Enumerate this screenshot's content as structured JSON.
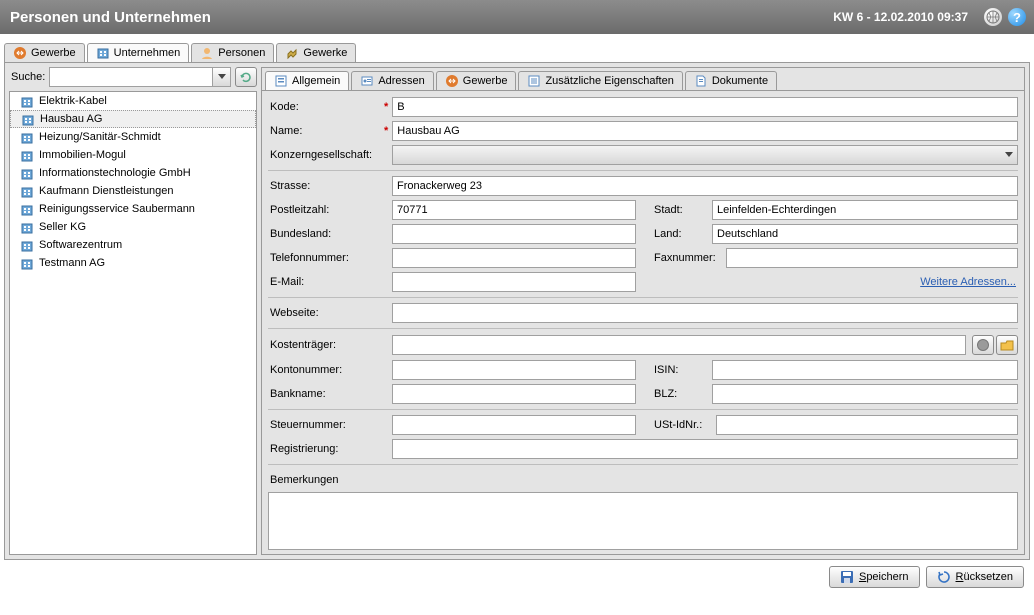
{
  "header": {
    "title": "Personen und Unternehmen",
    "date": "KW 6 - 12.02.2010 09:37"
  },
  "outer_tabs": [
    {
      "label": "Gewerbe",
      "icon": "gewerbe-icon"
    },
    {
      "label": "Unternehmen",
      "icon": "company-icon",
      "selected": true
    },
    {
      "label": "Personen",
      "icon": "person-icon"
    },
    {
      "label": "Gewerke",
      "icon": "gewerke-icon"
    }
  ],
  "search": {
    "label": "Suche:",
    "value": ""
  },
  "companies": [
    {
      "name": "Elektrik-Kabel"
    },
    {
      "name": "Hausbau AG",
      "selected": true
    },
    {
      "name": "Heizung/Sanitär-Schmidt"
    },
    {
      "name": "Immobilien-Mogul"
    },
    {
      "name": "Informationstechnologie GmbH"
    },
    {
      "name": "Kaufmann Dienstleistungen"
    },
    {
      "name": "Reinigungsservice Saubermann"
    },
    {
      "name": "Seller KG"
    },
    {
      "name": "Softwarezentrum"
    },
    {
      "name": "Testmann AG"
    }
  ],
  "inner_tabs": [
    {
      "label": "Allgemein",
      "icon": "general-icon",
      "selected": true
    },
    {
      "label": "Adressen",
      "icon": "address-icon"
    },
    {
      "label": "Gewerbe",
      "icon": "gewerbe-icon"
    },
    {
      "label": "Zusätzliche Eigenschaften",
      "icon": "properties-icon"
    },
    {
      "label": "Dokumente",
      "icon": "document-icon"
    }
  ],
  "labels": {
    "kode": "Kode:",
    "name": "Name:",
    "konzern": "Konzerngesellschaft:",
    "strasse": "Strasse:",
    "plz": "Postleitzahl:",
    "stadt": "Stadt:",
    "bundesland": "Bundesland:",
    "land": "Land:",
    "tel": "Telefonnummer:",
    "fax": "Faxnummer:",
    "email": "E-Mail:",
    "weitere": "Weitere Adressen...",
    "webseite": "Webseite:",
    "kostentraeger": "Kostenträger:",
    "kontonr": "Kontonummer:",
    "isin": "ISIN:",
    "bankname": "Bankname:",
    "blz": "BLZ:",
    "steuernr": "Steuernummer:",
    "ustid": "USt-IdNr.:",
    "registrierung": "Registrierung:",
    "bemerkungen": "Bemerkungen"
  },
  "values": {
    "kode": "B",
    "name": "Hausbau AG",
    "konzern": "",
    "strasse": "Fronackerweg 23",
    "plz": "70771",
    "stadt": "Leinfelden-Echterdingen",
    "bundesland": "",
    "land": "Deutschland",
    "tel": "",
    "fax": "",
    "email": "",
    "webseite": "",
    "kostentraeger": "",
    "kontonr": "",
    "isin": "",
    "bankname": "",
    "blz": "",
    "steuernr": "",
    "ustid": "",
    "registrierung": "",
    "bemerkungen": ""
  },
  "buttons": {
    "save": "Speichern",
    "reset": "Rücksetzen"
  }
}
